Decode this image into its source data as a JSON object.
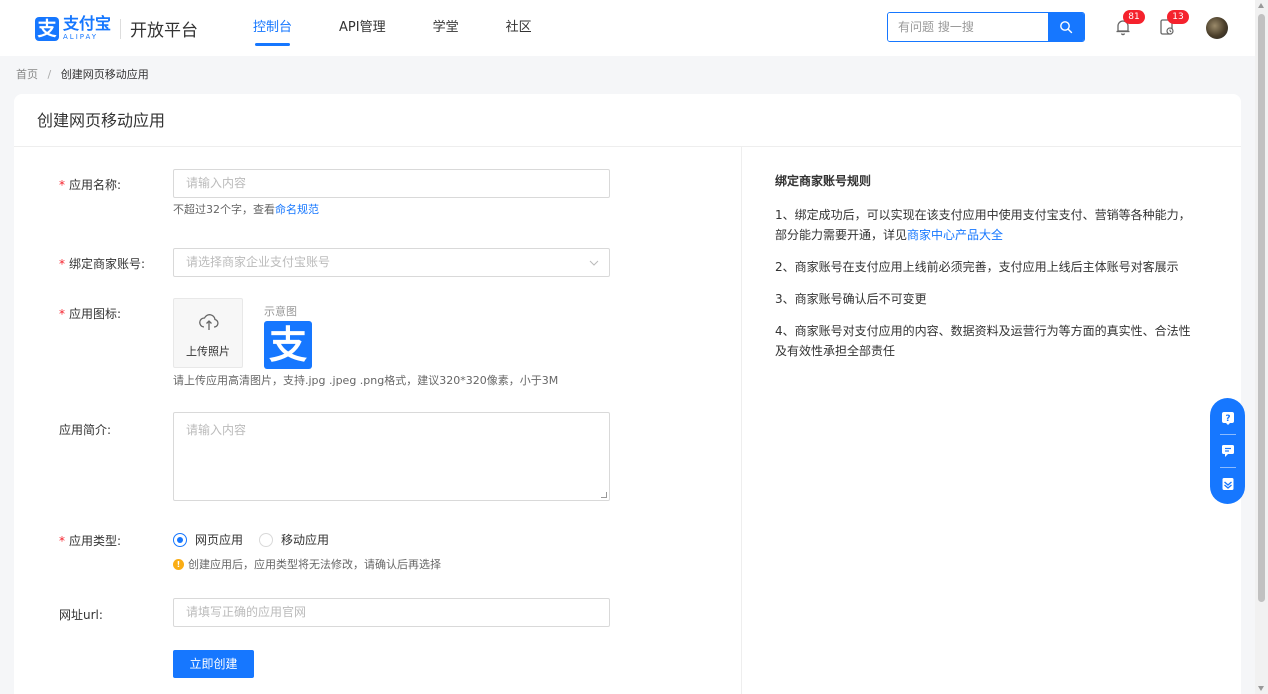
{
  "header": {
    "logo_mark": "支",
    "brand_cn": "支付宝",
    "brand_en": "ALIPAY",
    "platform": "开放平台",
    "nav": [
      {
        "label": "控制台",
        "active": true
      },
      {
        "label": "API管理",
        "active": false
      },
      {
        "label": "学堂",
        "active": false
      },
      {
        "label": "社区",
        "active": false
      }
    ],
    "search_placeholder": "有问题 搜一搜",
    "notifications_count": "81",
    "messages_count": "13"
  },
  "breadcrumb": {
    "home": "首页",
    "separator": "/",
    "current": "创建网页移动应用"
  },
  "page_title": "创建网页移动应用",
  "form": {
    "app_name": {
      "label": "应用名称:",
      "placeholder": "请输入内容",
      "help_prefix": "不超过32个字，查看",
      "help_link": "命名规范"
    },
    "merchant_account": {
      "label": "绑定商家账号:",
      "placeholder": "请选择商家企业支付宝账号"
    },
    "app_icon": {
      "label": "应用图标:",
      "upload_label": "上传照片",
      "sample_label": "示意图",
      "sample_glyph": "支",
      "help": "请上传应用高清图片，支持.jpg .jpeg .png格式，建议320*320像素，小于3M"
    },
    "app_intro": {
      "label": "应用简介:",
      "placeholder": "请输入内容"
    },
    "app_type": {
      "label": "应用类型:",
      "options": [
        {
          "label": "网页应用",
          "selected": true
        },
        {
          "label": "移动应用",
          "selected": false
        }
      ],
      "warning": "创建应用后，应用类型将无法修改，请确认后再选择"
    },
    "url": {
      "label": "网址url:",
      "placeholder": "请填写正确的应用官网"
    },
    "submit_label": "立即创建"
  },
  "rules": {
    "title": "绑定商家账号规则",
    "rule1_text": "1、绑定成功后，可以实现在该支付应用中使用支付宝支付、营销等各种能力，部分能力需要开通，详见",
    "rule1_link": "商家中心产品大全",
    "rule2": "2、商家账号在支付应用上线前必须完善，支付应用上线后主体账号对客展示",
    "rule3": "3、商家账号确认后不可变更",
    "rule4": "4、商家账号对支付应用的内容、数据资料及运营行为等方面的真实性、合法性及有效性承担全部责任"
  },
  "colors": {
    "primary": "#1677ff",
    "required": "#f5222d",
    "warning": "#faad14",
    "badge": "#f5222d"
  },
  "icons": [
    "search-icon",
    "bell-icon",
    "message-icon",
    "upload-cloud-icon",
    "chevron-down-icon",
    "help-icon",
    "chat-icon",
    "feedback-icon",
    "warning-icon"
  ]
}
